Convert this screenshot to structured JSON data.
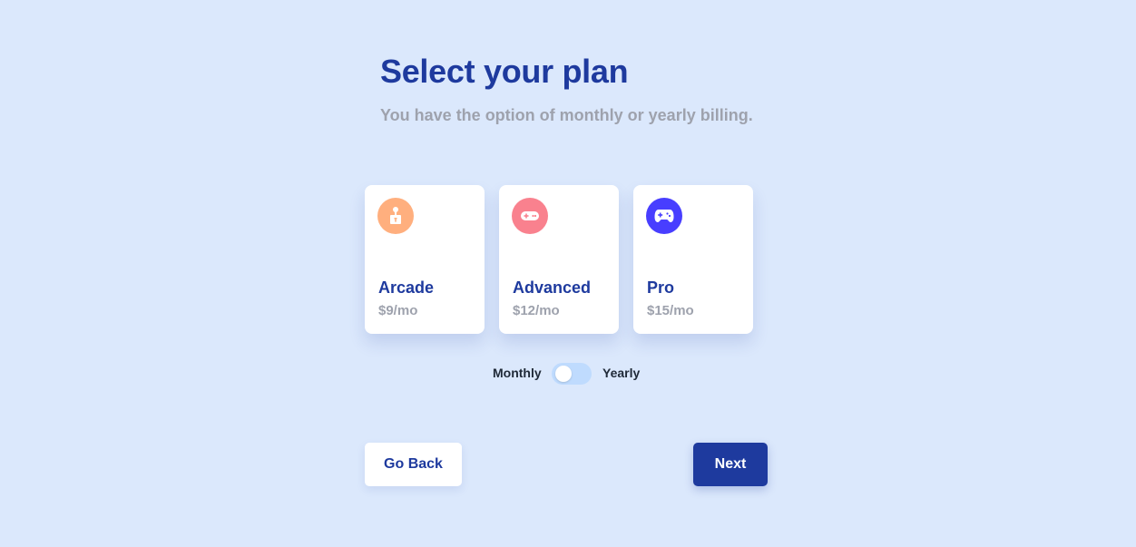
{
  "header": {
    "title": "Select your plan",
    "subtitle": "You have the option of monthly or yearly billing."
  },
  "plans": [
    {
      "name": "Arcade",
      "price": "$9/mo",
      "icon": "arcade-joystick-icon",
      "icon_color": "#ffaf7e"
    },
    {
      "name": "Advanced",
      "price": "$12/mo",
      "icon": "gamepad-icon",
      "icon_color": "#f9818e"
    },
    {
      "name": "Pro",
      "price": "$15/mo",
      "icon": "game-controller-icon",
      "icon_color": "#483eff"
    }
  ],
  "billing": {
    "monthly_label": "Monthly",
    "yearly_label": "Yearly",
    "selected": "Monthly"
  },
  "buttons": {
    "back_label": "Go Back",
    "next_label": "Next"
  },
  "colors": {
    "background": "#dbe8fc",
    "primary": "#1e3a9e",
    "muted_text": "#9ea2ad",
    "toggle_track": "#bfdbfe"
  }
}
